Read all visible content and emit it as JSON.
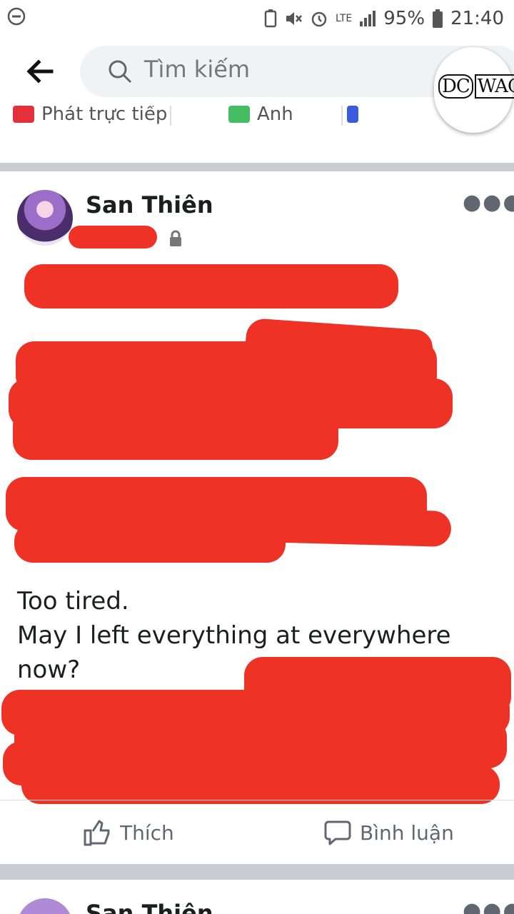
{
  "status_bar": {
    "network": "LTE",
    "battery": "95%",
    "time": "21:40"
  },
  "search": {
    "placeholder": "Tìm kiếm"
  },
  "watermark": {
    "text_left": "DC",
    "text_right": "WAC"
  },
  "composer": {
    "live_label": "Phát trực tiếp",
    "photo_label": "Ảnh"
  },
  "post": {
    "author": "San Thiên",
    "visible_lines": [
      "Too tired.",
      "May I left everything at everywhere",
      "now?"
    ],
    "like_label": "Thích",
    "comment_label": "Bình luận"
  },
  "next_post": {
    "author": "San Thiên"
  },
  "colors": {
    "redaction": "#ee3326",
    "divider": "#c9ccd1",
    "search_bg": "#f0f2f5",
    "action_text": "#606770"
  }
}
